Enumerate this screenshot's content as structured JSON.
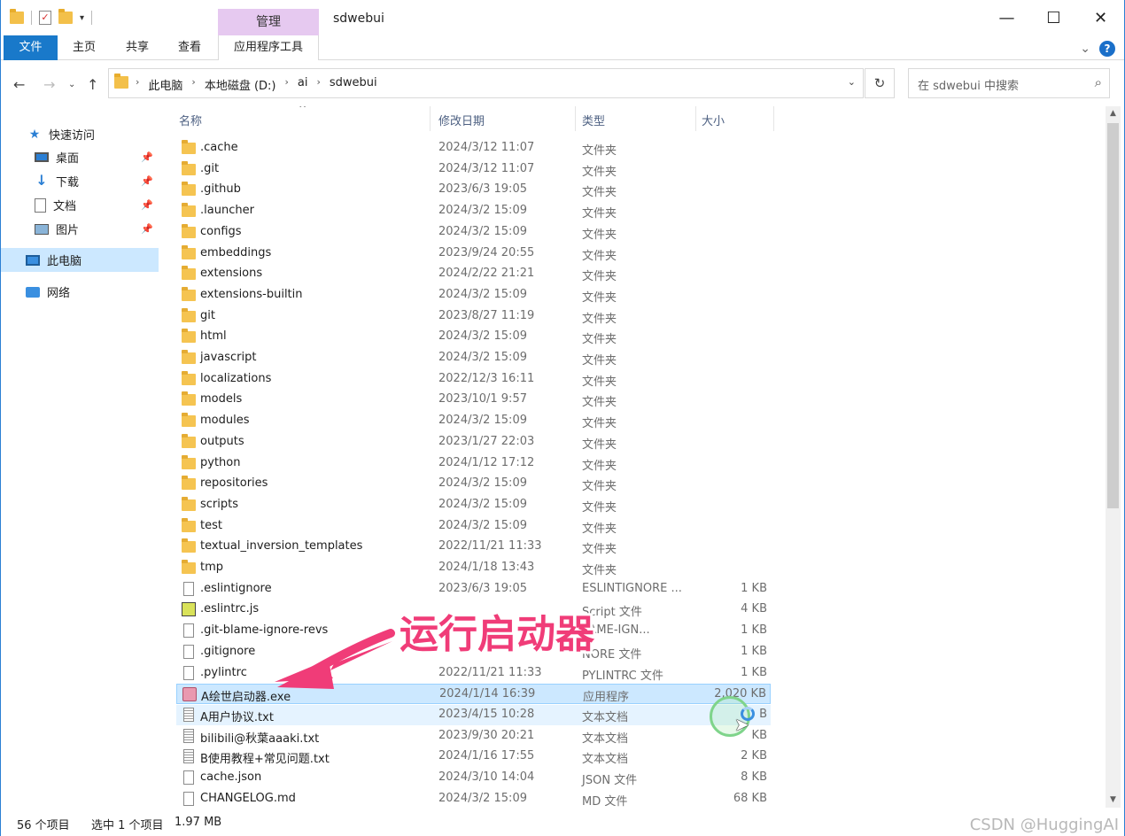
{
  "window": {
    "title": "sdwebui",
    "manage_tab": "管理",
    "controls": {
      "minimize": "—",
      "maximize": "☐",
      "close": "✕"
    }
  },
  "ribbon": {
    "tabs": [
      "文件",
      "主页",
      "共享",
      "查看"
    ],
    "app_tools": "应用程序工具",
    "collapse": "⌄",
    "help": "?"
  },
  "address": {
    "crumbs": [
      "此电脑",
      "本地磁盘 (D:)",
      "ai",
      "sdwebui"
    ],
    "search_placeholder": "在 sdwebui 中搜索"
  },
  "nav_pane": {
    "quick_access": "快速访问",
    "items": [
      "桌面",
      "下载",
      "文档",
      "图片"
    ],
    "this_pc": "此电脑",
    "network": "网络"
  },
  "columns": {
    "name": "名称",
    "date": "修改日期",
    "type": "类型",
    "size": "大小"
  },
  "files": [
    {
      "name": ".cache",
      "date": "2024/3/12 11:07",
      "type": "文件夹",
      "size": "",
      "icon": "folder"
    },
    {
      "name": ".git",
      "date": "2024/3/12 11:07",
      "type": "文件夹",
      "size": "",
      "icon": "folder"
    },
    {
      "name": ".github",
      "date": "2023/6/3 19:05",
      "type": "文件夹",
      "size": "",
      "icon": "folder"
    },
    {
      "name": ".launcher",
      "date": "2024/3/2 15:09",
      "type": "文件夹",
      "size": "",
      "icon": "folder"
    },
    {
      "name": "configs",
      "date": "2024/3/2 15:09",
      "type": "文件夹",
      "size": "",
      "icon": "folder"
    },
    {
      "name": "embeddings",
      "date": "2023/9/24 20:55",
      "type": "文件夹",
      "size": "",
      "icon": "folder"
    },
    {
      "name": "extensions",
      "date": "2024/2/22 21:21",
      "type": "文件夹",
      "size": "",
      "icon": "folder"
    },
    {
      "name": "extensions-builtin",
      "date": "2024/3/2 15:09",
      "type": "文件夹",
      "size": "",
      "icon": "folder"
    },
    {
      "name": "git",
      "date": "2023/8/27 11:19",
      "type": "文件夹",
      "size": "",
      "icon": "folder"
    },
    {
      "name": "html",
      "date": "2024/3/2 15:09",
      "type": "文件夹",
      "size": "",
      "icon": "folder"
    },
    {
      "name": "javascript",
      "date": "2024/3/2 15:09",
      "type": "文件夹",
      "size": "",
      "icon": "folder"
    },
    {
      "name": "localizations",
      "date": "2022/12/3 16:11",
      "type": "文件夹",
      "size": "",
      "icon": "folder"
    },
    {
      "name": "models",
      "date": "2023/10/1 9:57",
      "type": "文件夹",
      "size": "",
      "icon": "folder"
    },
    {
      "name": "modules",
      "date": "2024/3/2 15:09",
      "type": "文件夹",
      "size": "",
      "icon": "folder"
    },
    {
      "name": "outputs",
      "date": "2023/1/27 22:03",
      "type": "文件夹",
      "size": "",
      "icon": "folder"
    },
    {
      "name": "python",
      "date": "2024/1/12 17:12",
      "type": "文件夹",
      "size": "",
      "icon": "folder"
    },
    {
      "name": "repositories",
      "date": "2024/3/2 15:09",
      "type": "文件夹",
      "size": "",
      "icon": "folder"
    },
    {
      "name": "scripts",
      "date": "2024/3/2 15:09",
      "type": "文件夹",
      "size": "",
      "icon": "folder"
    },
    {
      "name": "test",
      "date": "2024/3/2 15:09",
      "type": "文件夹",
      "size": "",
      "icon": "folder"
    },
    {
      "name": "textual_inversion_templates",
      "date": "2022/11/21 11:33",
      "type": "文件夹",
      "size": "",
      "icon": "folder"
    },
    {
      "name": "tmp",
      "date": "2024/1/18 13:43",
      "type": "文件夹",
      "size": "",
      "icon": "folder"
    },
    {
      "name": ".eslintignore",
      "date": "2023/6/3 19:05",
      "type": "ESLINTIGNORE ...",
      "size": "1 KB",
      "icon": "file"
    },
    {
      "name": ".eslintrc.js",
      "date": "",
      "type": "Script 文件",
      "size": "4 KB",
      "icon": "js"
    },
    {
      "name": ".git-blame-ignore-revs",
      "date": "",
      "type": "LAME-IGN...",
      "size": "1 KB",
      "icon": "file"
    },
    {
      "name": ".gitignore",
      "date": "",
      "type": "NORE 文件",
      "size": "1 KB",
      "icon": "file"
    },
    {
      "name": ".pylintrc",
      "date": "2022/11/21 11:33",
      "type": "PYLINTRC 文件",
      "size": "1 KB",
      "icon": "file"
    },
    {
      "name": "A绘世启动器.exe",
      "date": "2024/1/14 16:39",
      "type": "应用程序",
      "size": "2,020 KB",
      "icon": "exe",
      "state": "selected"
    },
    {
      "name": "A用户协议.txt",
      "date": "2023/4/15 10:28",
      "type": "文本文档",
      "size": "B",
      "icon": "txt",
      "state": "hover"
    },
    {
      "name": "bilibili@秋葉aaaki.txt",
      "date": "2023/9/30 20:21",
      "type": "文本文档",
      "size": "KB",
      "icon": "txt"
    },
    {
      "name": "B使用教程+常见问题.txt",
      "date": "2024/1/16 17:55",
      "type": "文本文档",
      "size": "2 KB",
      "icon": "txt"
    },
    {
      "name": "cache.json",
      "date": "2024/3/10 14:04",
      "type": "JSON 文件",
      "size": "8 KB",
      "icon": "file"
    },
    {
      "name": "CHANGELOG.md",
      "date": "2024/3/2 15:09",
      "type": "MD 文件",
      "size": "68 KB",
      "icon": "file"
    }
  ],
  "status": {
    "count": "56 个项目",
    "selection": "选中 1 个项目",
    "size": "1.97 MB",
    "watermark": "CSDN @HuggingAI"
  },
  "annotation": {
    "text": "运行启动器",
    "color": "#f03c78"
  },
  "colors": {
    "accent": "#1979ca",
    "selection": "#cce8ff",
    "manage_tab": "#e6c9f0",
    "folder": "#f5c451"
  }
}
